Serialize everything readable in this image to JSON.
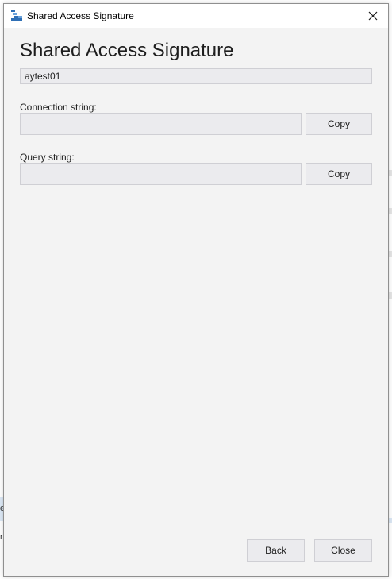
{
  "window": {
    "title": "Shared Access Signature"
  },
  "main": {
    "heading": "Shared Access Signature",
    "account_name_value": "aytest01",
    "connection_string": {
      "label": "Connection string:",
      "value": "",
      "copy_label": "Copy"
    },
    "query_string": {
      "label": "Query string:",
      "value": "",
      "copy_label": "Copy"
    }
  },
  "footer": {
    "back_label": "Back",
    "close_label": "Close"
  },
  "background": {
    "left_chars": [
      "e",
      "r"
    ]
  },
  "colors": {
    "dialog_bg": "#f3f3f3",
    "field_bg": "#ebebee",
    "field_border": "#cfcfd4",
    "icon_blue": "#2f6fb5"
  }
}
